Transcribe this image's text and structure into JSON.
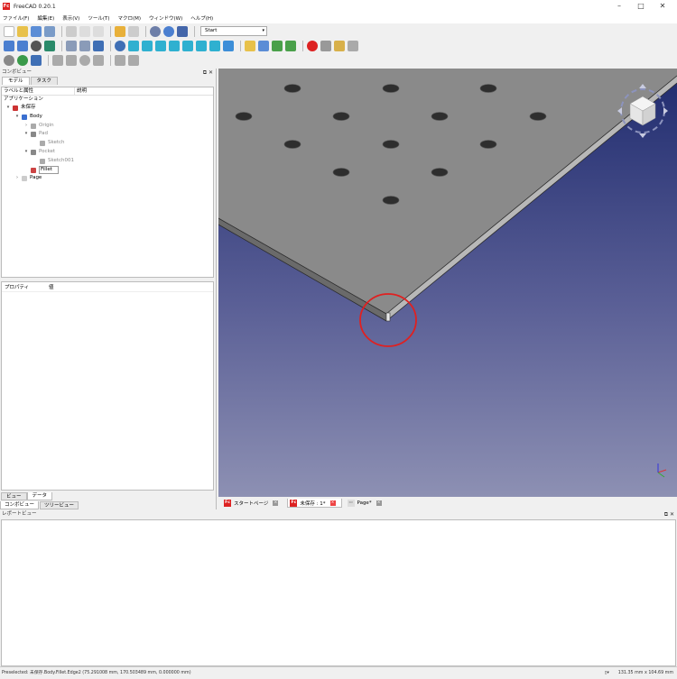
{
  "window": {
    "title": "FreeCAD 0.20.1",
    "app_icon": "Fc",
    "minimize": "–",
    "maximize": "□",
    "close": "✕"
  },
  "menu": [
    "ファイル(F)",
    "編集(E)",
    "表示(V)",
    "ツール(T)",
    "マクロ(M)",
    "ウィンドウ(W)",
    "ヘルプ(H)"
  ],
  "toolbar": {
    "workbench_select": "Start",
    "workbench_arrow": "▾"
  },
  "combo_view": {
    "header": "コンボビュー",
    "header_icons": "⧉ ✕",
    "tabs": [
      "モデル",
      "タスク"
    ],
    "tree_columns": [
      "ラベルと属性",
      "説明"
    ],
    "tree_section": "アプリケーション",
    "tree": [
      {
        "label": "未保存",
        "depth": 0,
        "expander": "▾",
        "icon_color": "#c33"
      },
      {
        "label": "Body",
        "depth": 1,
        "expander": "▾",
        "icon_color": "#3a6fd0"
      },
      {
        "label": "Origin",
        "depth": 2,
        "expander": "›",
        "icon_color": "#aaa",
        "gray": true
      },
      {
        "label": "Pad",
        "depth": 2,
        "expander": "▾",
        "icon_color": "#888",
        "gray": true
      },
      {
        "label": "Sketch",
        "depth": 3,
        "expander": "",
        "icon_color": "#aaa",
        "gray": true
      },
      {
        "label": "Pocket",
        "depth": 2,
        "expander": "▾",
        "icon_color": "#888",
        "gray": true
      },
      {
        "label": "Sketch001",
        "depth": 3,
        "expander": "",
        "icon_color": "#aaa",
        "gray": true
      },
      {
        "label": "Fillet",
        "depth": 2,
        "expander": "",
        "icon_color": "#c44",
        "selected": true
      },
      {
        "label": "Page",
        "depth": 1,
        "expander": "›",
        "icon_color": "#ccc"
      }
    ],
    "property_columns": [
      "プロパティ",
      "値"
    ],
    "sub_tabs": [
      "ビュー",
      "データ"
    ],
    "bottom_tabs": [
      "コンボビュー",
      "ツリービュー"
    ]
  },
  "document_tabs": [
    {
      "label": "スタートページ",
      "icon": "Fc",
      "close": "×"
    },
    {
      "label": "未保存 : 1*",
      "icon": "Fc",
      "close": "×",
      "active": true
    },
    {
      "label": "Page*",
      "icon": "▭",
      "close": "×"
    }
  ],
  "report_view": {
    "header": "レポートビュー",
    "header_icons": "⧉ ✕",
    "content": ""
  },
  "status": {
    "preselected": "Preselected: 未保存.Body.Fillet.Edge2 (75.291008 mm, 170.503489 mm, 0.000000 mm)",
    "nav_icon": "▯▾",
    "dimensions": "131.35 mm x 104.69 mm"
  },
  "viewport": {
    "highlight_color": "#e02020",
    "plate_color": "#8a8a8a",
    "plate_edge_color": "#b8b8b8",
    "background_top": "#1f2b6e",
    "background_bottom": "#8d90b3"
  }
}
